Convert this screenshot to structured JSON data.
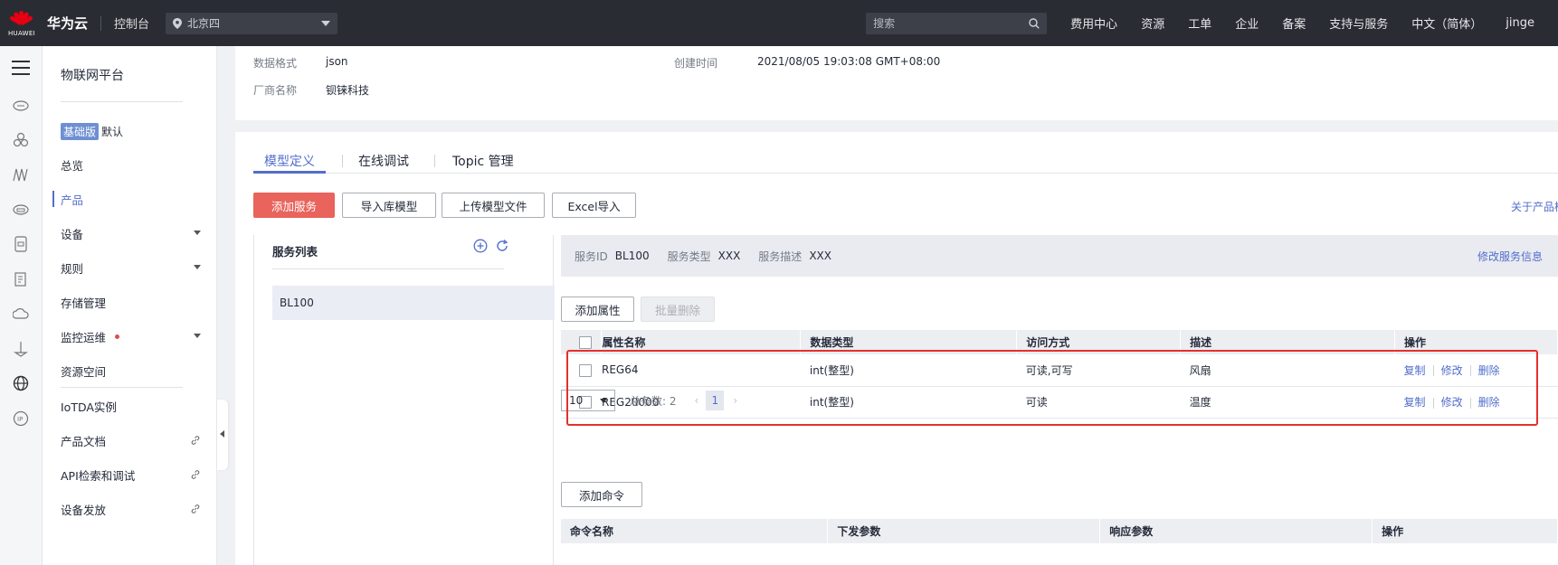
{
  "topbar": {
    "logo_text": "HUAWEI",
    "brand": "华为云",
    "console": "控制台",
    "region": "北京四",
    "search_placeholder": "搜索",
    "nav": [
      "费用中心",
      "资源",
      "工单",
      "企业",
      "备案",
      "支持与服务",
      "中文（简体）",
      "jinge"
    ]
  },
  "sidebar": {
    "title": "物联网平台",
    "edition_badge": "基础版",
    "edition_value": "默认",
    "items": [
      "总览",
      "产品",
      "设备",
      "规则",
      "存储管理",
      "监控运维",
      "资源空间",
      "IoTDA实例",
      "产品文档",
      "API检索和调试",
      "设备发放"
    ]
  },
  "info": {
    "data_format_label": "数据格式",
    "data_format_value": "json",
    "created_label": "创建时间",
    "created_value": "2021/08/05 19:03:08 GMT+08:00",
    "vendor_label": "厂商名称",
    "vendor_value": "钡铼科技"
  },
  "tabs": [
    "模型定义",
    "在线调试",
    "Topic 管理"
  ],
  "toolbar": {
    "add_service": "添加服务",
    "import_library": "导入库模型",
    "upload_model": "上传模型文件",
    "excel_import": "Excel导入",
    "about_link": "关于产品模"
  },
  "service_list": {
    "title": "服务列表",
    "items": [
      "BL100"
    ]
  },
  "service_info": {
    "id_label": "服务ID",
    "id_value": "BL100",
    "type_label": "服务类型",
    "type_value": "XXX",
    "desc_label": "服务描述",
    "desc_value": "XXX",
    "edit_link": "修改服务信息"
  },
  "properties": {
    "add_button": "添加属性",
    "batch_delete_button": "批量删除",
    "columns": [
      "属性名称",
      "数据类型",
      "访问方式",
      "描述",
      "操作"
    ],
    "rows": [
      {
        "name": "REG64",
        "type": "int(整型)",
        "access": "可读,可写",
        "desc": "风扇"
      },
      {
        "name": "REG20000",
        "type": "int(整型)",
        "access": "可读",
        "desc": "温度"
      }
    ],
    "actions": [
      "复制",
      "修改",
      "删除"
    ]
  },
  "pagination": {
    "page_size": "10",
    "total": "总条数: 2",
    "current_page": "1",
    "prev": "‹",
    "next": "›"
  },
  "commands": {
    "add_button": "添加命令",
    "columns": [
      "命令名称",
      "下发参数",
      "响应参数",
      "操作"
    ]
  },
  "colors": {
    "accent": "#526ecc",
    "primary_button": "#e8645c",
    "highlight_box": "#e5302a",
    "topbar": "#2a2c33"
  }
}
